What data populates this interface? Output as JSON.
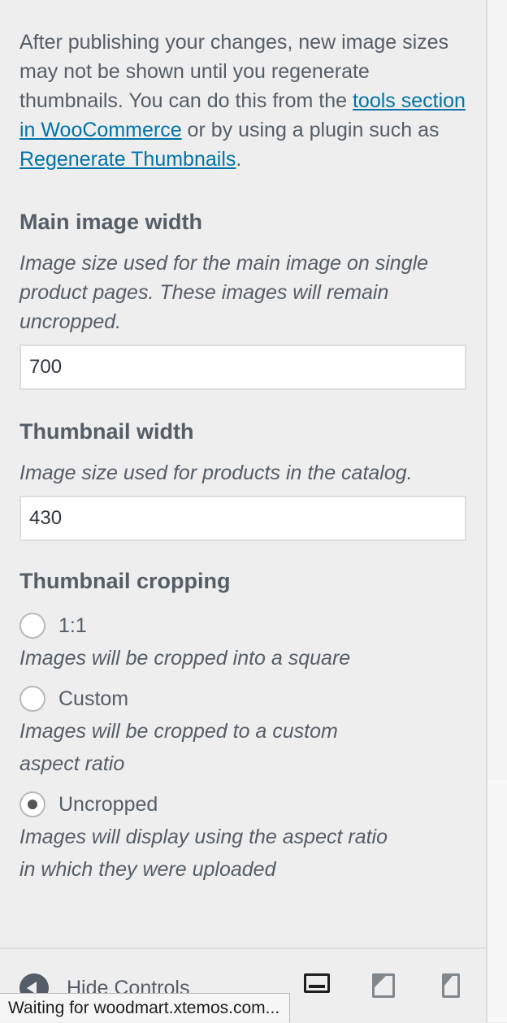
{
  "intro": {
    "text_before": "After publishing your changes, new image sizes may not be shown until you regenerate thumbnails. You can do this from the ",
    "link_tools": "tools section in WooCommerce",
    "text_middle": " or by using a plugin such as ",
    "link_regenerate": "Regenerate Thumbnails",
    "text_after": "."
  },
  "main_image": {
    "title": "Main image width",
    "description": "Image size used for the main image on single product pages. These images will remain uncropped.",
    "value": "700"
  },
  "thumbnail": {
    "title": "Thumbnail width",
    "description": "Image size used for products in the catalog.",
    "value": "430"
  },
  "cropping": {
    "title": "Thumbnail cropping",
    "options": [
      {
        "label": "1:1",
        "description": "Images will be cropped into a square",
        "checked": false
      },
      {
        "label": "Custom",
        "description": "Images will be cropped to a custom aspect ratio",
        "checked": false
      },
      {
        "label": "Uncropped",
        "description": "Images will display using the aspect ratio in which they were uploaded",
        "checked": true
      }
    ]
  },
  "footer": {
    "hide_controls_label": "Hide Controls",
    "collapse_icon": "collapse-arrow-icon",
    "devices": [
      "desktop-icon",
      "tablet-icon",
      "mobile-icon"
    ],
    "active_device": "desktop"
  },
  "status": {
    "text": "Waiting for woodmart.xtemos.com..."
  },
  "colors": {
    "link": "#0073aa",
    "text": "#555d66",
    "panel_bg": "#eeeeee"
  }
}
